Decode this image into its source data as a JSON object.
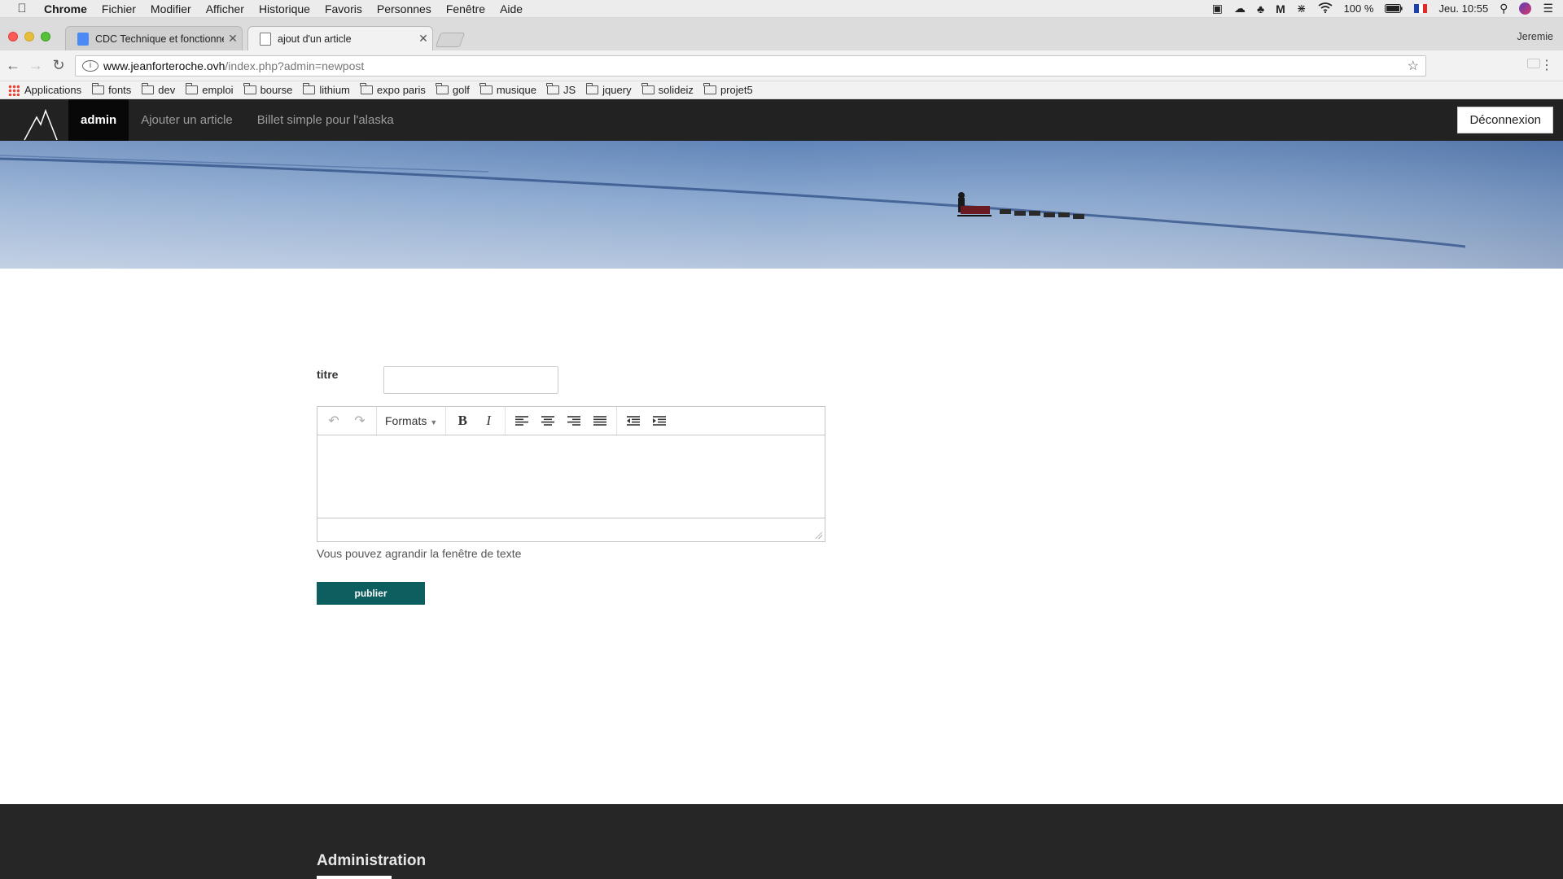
{
  "menubar": {
    "app": "Chrome",
    "items": [
      "Fichier",
      "Modifier",
      "Afficher",
      "Historique",
      "Favoris",
      "Personnes",
      "Fenêtre",
      "Aide"
    ],
    "battery": "100 %",
    "clock": "Jeu. 10:55"
  },
  "tabs": [
    {
      "title": "CDC Technique et fonctionnel"
    },
    {
      "title": "ajout d'un article"
    }
  ],
  "profile": "Jeremie",
  "address": {
    "host": "www.jeanforteroche.ovh",
    "path": "/index.php?admin=newpost"
  },
  "bookmarks": [
    "Applications",
    "fonts",
    "dev",
    "emploi",
    "bourse",
    "lithium",
    "expo paris",
    "golf",
    "musique",
    "JS",
    "jquery",
    "solideiz",
    "projet5"
  ],
  "sitenav": {
    "items": [
      "admin",
      "Ajouter un article",
      "Billet simple pour l'alaska"
    ],
    "logout": "Déconnexion"
  },
  "form": {
    "title_label": "titre",
    "title_value": "",
    "formats": "Formats",
    "hint": "Vous pouvez agrandir la fenêtre de texte",
    "publish": "publier"
  },
  "footer": {
    "title": "Administration"
  },
  "colors": {
    "navbar": "#222222",
    "publish": "#0d5e5f",
    "footer": "#262626"
  }
}
